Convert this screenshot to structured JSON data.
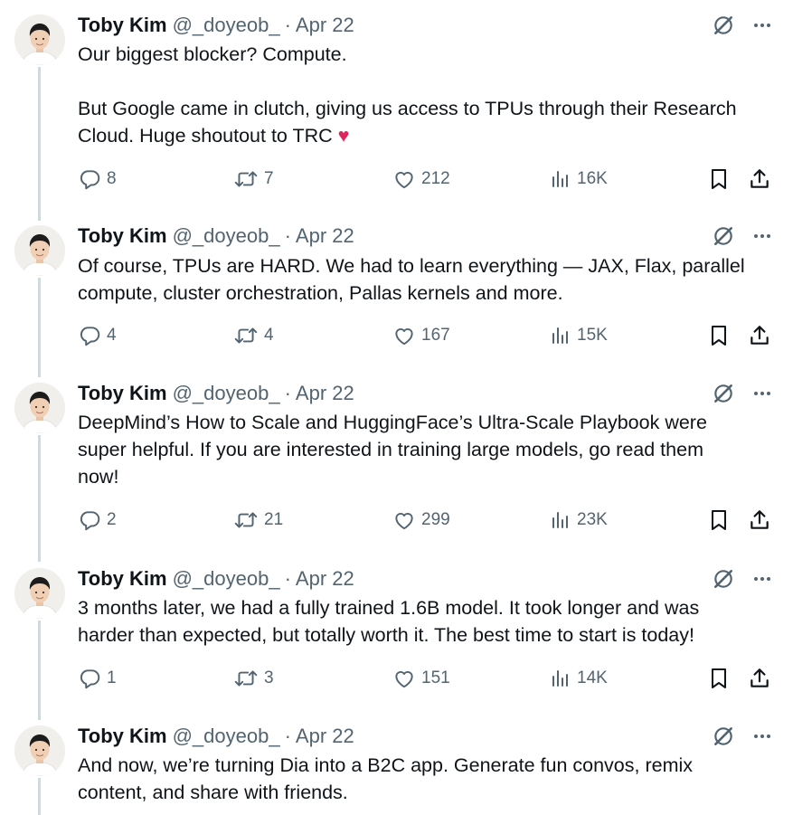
{
  "tweets": [
    {
      "name": "Toby Kim",
      "handle": "@_doyeob_",
      "separator": "·",
      "date": "Apr 22",
      "text_lines": [
        "Our biggest blocker? Compute.",
        "",
        "But Google came in clutch, giving us access to TPUs through their Research",
        "Cloud. Huge shoutout to TRC "
      ],
      "emoji": "♥",
      "replies": "8",
      "retweets": "7",
      "likes": "212",
      "views": "16K"
    },
    {
      "name": "Toby Kim",
      "handle": "@_doyeob_",
      "separator": "·",
      "date": "Apr 22",
      "text_lines": [
        "Of course, TPUs are HARD. We had to learn everything — JAX, Flax, parallel",
        "compute, cluster orchestration, Pallas kernels and more."
      ],
      "replies": "4",
      "retweets": "4",
      "likes": "167",
      "views": "15K"
    },
    {
      "name": "Toby Kim",
      "handle": "@_doyeob_",
      "separator": "·",
      "date": "Apr 22",
      "text_lines": [
        "DeepMind’s How to Scale and HuggingFace’s Ultra-Scale Playbook were",
        "super helpful. If you are interested in training large models, go read them",
        "now!"
      ],
      "replies": "2",
      "retweets": "21",
      "likes": "299",
      "views": "23K"
    },
    {
      "name": "Toby Kim",
      "handle": "@_doyeob_",
      "separator": "·",
      "date": "Apr 22",
      "text_lines": [
        "3 months later, we had a fully trained 1.6B model. It took longer and was",
        "harder than expected, but totally worth it. The best time to start is today!"
      ],
      "replies": "1",
      "retweets": "3",
      "likes": "151",
      "views": "14K"
    },
    {
      "name": "Toby Kim",
      "handle": "@_doyeob_",
      "separator": "·",
      "date": "Apr 22",
      "text_lines": [
        "And now, we’re turning Dia into a B2C app. Generate fun convos, remix",
        "content, and share with friends."
      ]
    }
  ],
  "icons": {
    "reply": "reply-icon",
    "retweet": "retweet-icon",
    "like": "like-icon",
    "views": "views-icon",
    "bookmark": "bookmark-icon",
    "share": "share-icon",
    "grok": "grok-icon",
    "more": "more-icon"
  },
  "colors": {
    "text": "#0f1419",
    "secondary": "#536471",
    "thread_line": "#cfd9de",
    "heart": "#e0245e"
  }
}
